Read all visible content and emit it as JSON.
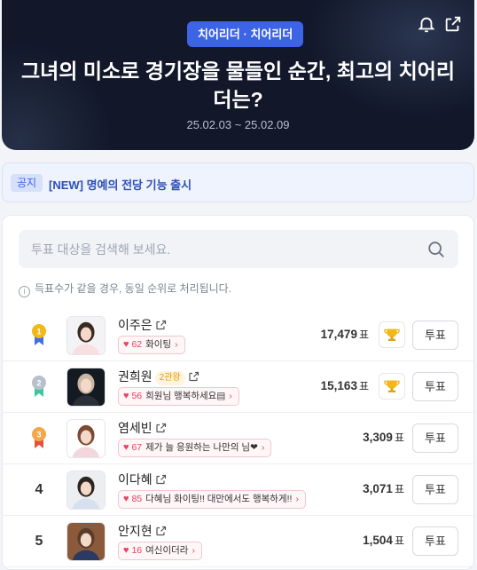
{
  "hero": {
    "tag": "치어리더 · 치어리더",
    "title": "그녀의 미소로 경기장을 물들인 순간, 최고의 치어리더는?",
    "date_range": "25.02.03 ~ 25.02.09"
  },
  "notice": {
    "badge": "공지",
    "text": "[NEW] 명예의 전당 기능 출시"
  },
  "search": {
    "placeholder": "투표 대상을 검색해 보세요."
  },
  "info_text": "득표수가 같을 경우, 동일 순위로 처리됩니다.",
  "vote_unit": "표",
  "vote_label": "투표",
  "candidates": [
    {
      "rank": "1",
      "name": "이주은",
      "extra": "",
      "cheer_count": "62",
      "cheer_text": "화이팅",
      "votes": "17,479",
      "trophy": true
    },
    {
      "rank": "2",
      "name": "권희원",
      "extra": "2관왕",
      "cheer_count": "56",
      "cheer_text": "희원님 행복하세요▤",
      "votes": "15,163",
      "trophy": true
    },
    {
      "rank": "3",
      "name": "염세빈",
      "extra": "",
      "cheer_count": "67",
      "cheer_text": "제가 늘 응원하는 나만의 님❤",
      "votes": "3,309",
      "trophy": false
    },
    {
      "rank": "4",
      "name": "이다혜",
      "extra": "",
      "cheer_count": "85",
      "cheer_text": "다혜님 화이팅!! 대만에서도 행복하게!!",
      "votes": "3,071",
      "trophy": false
    },
    {
      "rank": "5",
      "name": "안지현",
      "extra": "",
      "cheer_count": "16",
      "cheer_text": "여신이더라",
      "votes": "1,504",
      "trophy": false
    }
  ],
  "colors": {
    "accent": "#3d63e6",
    "gold": "#f2b818",
    "silver": "#b9c0cc",
    "bronze": "#f1a94a",
    "heart": "#e8415f"
  }
}
